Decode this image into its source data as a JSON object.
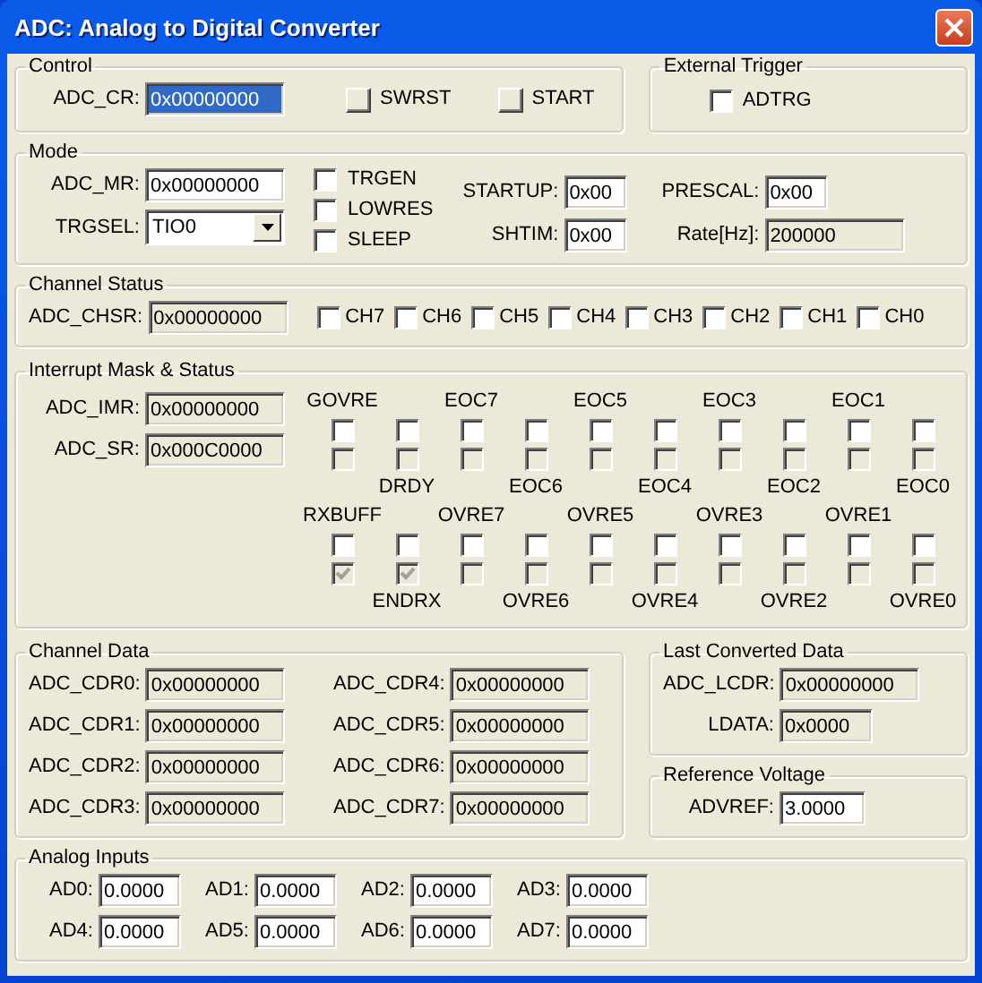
{
  "window": {
    "title": "ADC: Analog to Digital Converter"
  },
  "control": {
    "title": "Control",
    "register": {
      "label": "ADC_CR:",
      "value": "0x00000000",
      "selected": true,
      "read_only": false
    },
    "buttons": [
      {
        "label": "SWRST"
      },
      {
        "label": "START"
      }
    ]
  },
  "external_trigger": {
    "title": "External Trigger",
    "checkboxes": [
      {
        "label": "ADTRG",
        "checked": false
      }
    ]
  },
  "mode": {
    "title": "Mode",
    "register": {
      "label": "ADC_MR:",
      "value": "0x00000000",
      "read_only": false
    },
    "trgsel": {
      "label": "TRGSEL:",
      "value": "TIO0"
    },
    "flags": [
      {
        "label": "TRGEN",
        "checked": false
      },
      {
        "label": "LOWRES",
        "checked": false
      },
      {
        "label": "SLEEP",
        "checked": false
      }
    ],
    "startup": {
      "label": "STARTUP:",
      "value": "0x00",
      "read_only": false
    },
    "shtim": {
      "label": "SHTIM:",
      "value": "0x00",
      "read_only": false
    },
    "prescal": {
      "label": "PRESCAL:",
      "value": "0x00",
      "read_only": false
    },
    "rate": {
      "label": "Rate[Hz]:",
      "value": "200000",
      "read_only": true
    }
  },
  "channel_status": {
    "title": "Channel Status",
    "register": {
      "label": "ADC_CHSR:",
      "value": "0x00000000",
      "read_only": true
    },
    "channels": [
      {
        "label": "CH7",
        "checked": false
      },
      {
        "label": "CH6",
        "checked": false
      },
      {
        "label": "CH5",
        "checked": false
      },
      {
        "label": "CH4",
        "checked": false
      },
      {
        "label": "CH3",
        "checked": false
      },
      {
        "label": "CH2",
        "checked": false
      },
      {
        "label": "CH1",
        "checked": false
      },
      {
        "label": "CH0",
        "checked": false
      }
    ]
  },
  "interrupt": {
    "title": "Interrupt Mask & Status",
    "registers": [
      {
        "label": "ADC_IMR:",
        "value": "0x00000000",
        "read_only": true
      },
      {
        "label": "ADC_SR:",
        "value": "0x000C0000",
        "read_only": true
      }
    ],
    "bit_rows": [
      {
        "bits": [
          {
            "label": "GOVRE",
            "mask": false,
            "status": false
          },
          {
            "label": "DRDY",
            "mask": false,
            "status": false
          },
          {
            "label": "EOC7",
            "mask": false,
            "status": false
          },
          {
            "label": "EOC6",
            "mask": false,
            "status": false
          },
          {
            "label": "EOC5",
            "mask": false,
            "status": false
          },
          {
            "label": "EOC4",
            "mask": false,
            "status": false
          },
          {
            "label": "EOC3",
            "mask": false,
            "status": false
          },
          {
            "label": "EOC2",
            "mask": false,
            "status": false
          },
          {
            "label": "EOC1",
            "mask": false,
            "status": false
          },
          {
            "label": "EOC0",
            "mask": false,
            "status": false
          }
        ]
      },
      {
        "bits": [
          {
            "label": "RXBUFF",
            "mask": false,
            "status": true
          },
          {
            "label": "ENDRX",
            "mask": false,
            "status": true
          },
          {
            "label": "OVRE7",
            "mask": false,
            "status": false
          },
          {
            "label": "OVRE6",
            "mask": false,
            "status": false
          },
          {
            "label": "OVRE5",
            "mask": false,
            "status": false
          },
          {
            "label": "OVRE4",
            "mask": false,
            "status": false
          },
          {
            "label": "OVRE3",
            "mask": false,
            "status": false
          },
          {
            "label": "OVRE2",
            "mask": false,
            "status": false
          },
          {
            "label": "OVRE1",
            "mask": false,
            "status": false
          },
          {
            "label": "OVRE0",
            "mask": false,
            "status": false
          }
        ]
      }
    ]
  },
  "channel_data": {
    "title": "Channel Data",
    "registers": [
      {
        "label": "ADC_CDR0:",
        "value": "0x00000000",
        "read_only": true
      },
      {
        "label": "ADC_CDR1:",
        "value": "0x00000000",
        "read_only": true
      },
      {
        "label": "ADC_CDR2:",
        "value": "0x00000000",
        "read_only": true
      },
      {
        "label": "ADC_CDR3:",
        "value": "0x00000000",
        "read_only": true
      },
      {
        "label": "ADC_CDR4:",
        "value": "0x00000000",
        "read_only": true
      },
      {
        "label": "ADC_CDR5:",
        "value": "0x00000000",
        "read_only": true
      },
      {
        "label": "ADC_CDR6:",
        "value": "0x00000000",
        "read_only": true
      },
      {
        "label": "ADC_CDR7:",
        "value": "0x00000000",
        "read_only": true
      }
    ]
  },
  "last_converted": {
    "title": "Last Converted Data",
    "fields": [
      {
        "label": "ADC_LCDR:",
        "value": "0x00000000",
        "read_only": true
      },
      {
        "label": "LDATA:",
        "value": "0x0000",
        "read_only": true
      }
    ]
  },
  "reference_voltage": {
    "title": "Reference Voltage",
    "field": {
      "label": "ADVREF:",
      "value": "3.0000",
      "read_only": false
    }
  },
  "analog_inputs": {
    "title": "Analog Inputs",
    "inputs": [
      {
        "label": "AD0:",
        "value": "0.0000",
        "read_only": false
      },
      {
        "label": "AD1:",
        "value": "0.0000",
        "read_only": false
      },
      {
        "label": "AD2:",
        "value": "0.0000",
        "read_only": false
      },
      {
        "label": "AD3:",
        "value": "0.0000",
        "read_only": false
      },
      {
        "label": "AD4:",
        "value": "0.0000",
        "read_only": false
      },
      {
        "label": "AD5:",
        "value": "0.0000",
        "read_only": false
      },
      {
        "label": "AD6:",
        "value": "0.0000",
        "read_only": false
      },
      {
        "label": "AD7:",
        "value": "0.0000",
        "read_only": false
      }
    ]
  }
}
